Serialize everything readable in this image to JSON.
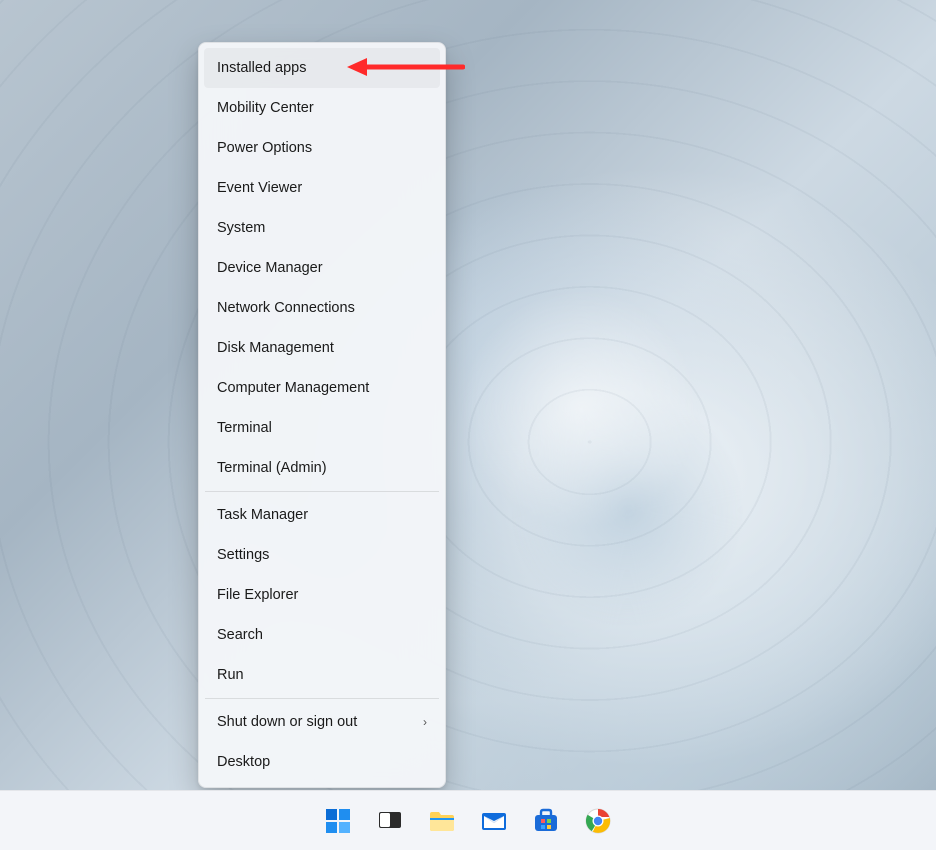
{
  "contextMenu": {
    "groups": [
      [
        {
          "id": "installed-apps",
          "label": "Installed apps",
          "highlighted": true,
          "annotated": true
        },
        {
          "id": "mobility-center",
          "label": "Mobility Center"
        },
        {
          "id": "power-options",
          "label": "Power Options"
        },
        {
          "id": "event-viewer",
          "label": "Event Viewer"
        },
        {
          "id": "system",
          "label": "System"
        },
        {
          "id": "device-manager",
          "label": "Device Manager"
        },
        {
          "id": "network-connections",
          "label": "Network Connections"
        },
        {
          "id": "disk-management",
          "label": "Disk Management"
        },
        {
          "id": "computer-management",
          "label": "Computer Management"
        },
        {
          "id": "terminal",
          "label": "Terminal"
        },
        {
          "id": "terminal-admin",
          "label": "Terminal (Admin)"
        }
      ],
      [
        {
          "id": "task-manager",
          "label": "Task Manager"
        },
        {
          "id": "settings",
          "label": "Settings"
        },
        {
          "id": "file-explorer",
          "label": "File Explorer"
        },
        {
          "id": "search",
          "label": "Search"
        },
        {
          "id": "run",
          "label": "Run"
        }
      ],
      [
        {
          "id": "shut-down",
          "label": "Shut down or sign out",
          "submenu": true
        },
        {
          "id": "desktop",
          "label": "Desktop"
        }
      ]
    ]
  },
  "annotation": {
    "color": "#ff2a2a"
  },
  "taskbar": {
    "items": [
      {
        "id": "start",
        "name": "start-button"
      },
      {
        "id": "taskview",
        "name": "task-view-button"
      },
      {
        "id": "explorer",
        "name": "file-explorer-button"
      },
      {
        "id": "mail",
        "name": "mail-button"
      },
      {
        "id": "store",
        "name": "microsoft-store-button"
      },
      {
        "id": "chrome",
        "name": "chrome-button"
      }
    ]
  }
}
